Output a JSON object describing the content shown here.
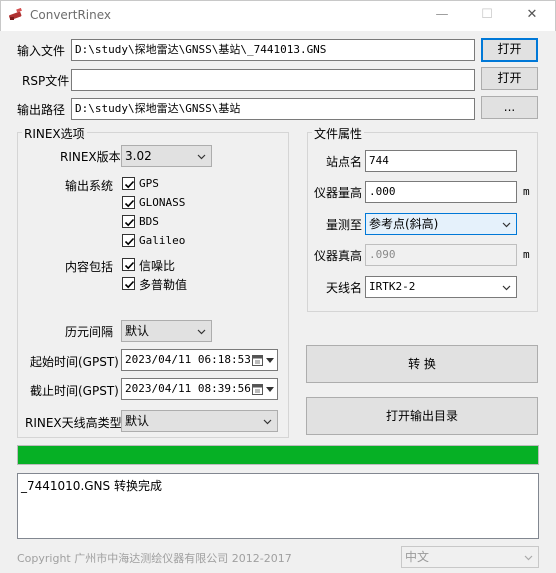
{
  "window": {
    "title": "ConvertRinex",
    "minimize": "—",
    "maximize": "☐",
    "close": "✕"
  },
  "files": {
    "input_label": "输入文件",
    "input_value": "D:\\study\\探地雷达\\GNSS\\基站\\_7441013.GNS",
    "input_button": "打开",
    "rsp_label": "RSP文件",
    "rsp_value": "",
    "rsp_button": "打开",
    "output_label": "输出路径",
    "output_value": "D:\\study\\探地雷达\\GNSS\\基站",
    "output_button": "..."
  },
  "rinex": {
    "group_title": "RINEX选项",
    "version_label": "RINEX版本",
    "version_value": "3.02",
    "systems_label": "输出系统",
    "systems": [
      {
        "name": "GPS",
        "checked": true
      },
      {
        "name": "GLONASS",
        "checked": true
      },
      {
        "name": "BDS",
        "checked": true
      },
      {
        "name": "Galileo",
        "checked": true
      }
    ],
    "content_label": "内容包括",
    "content": [
      {
        "name": "信噪比",
        "checked": true
      },
      {
        "name": "多普勒值",
        "checked": true
      }
    ],
    "epoch_label": "历元间隔",
    "epoch_value": "默认",
    "start_label": "起始时间(GPST)",
    "start_value": "2023/04/11 06:18:53",
    "end_label": "截止时间(GPST)",
    "end_value": "2023/04/11 08:39:56",
    "antenna_type_label": "RINEX天线高类型",
    "antenna_type_value": "默认"
  },
  "file_attrs": {
    "group_title": "文件属性",
    "station_label": "站点名",
    "station_value": "744",
    "inst_height_label": "仪器量高",
    "inst_height_value": ".000",
    "inst_height_unit": "m",
    "measure_to_label": "量测至",
    "measure_to_value": "参考点(斜高)",
    "true_height_label": "仪器真高",
    "true_height_value": ".090",
    "true_height_unit": "m",
    "antenna_label": "天线名",
    "antenna_value": "IRTK2-2"
  },
  "actions": {
    "convert": "转 换",
    "open_output": "打开输出目录"
  },
  "progress": {
    "fraction": 1.0,
    "color": "#06b025"
  },
  "log": {
    "text": "_7441010.GNS 转换完成"
  },
  "footer": {
    "copyright": "Copyright  广州市中海达测绘仪器有限公司 2012-2017",
    "language": "中文"
  }
}
